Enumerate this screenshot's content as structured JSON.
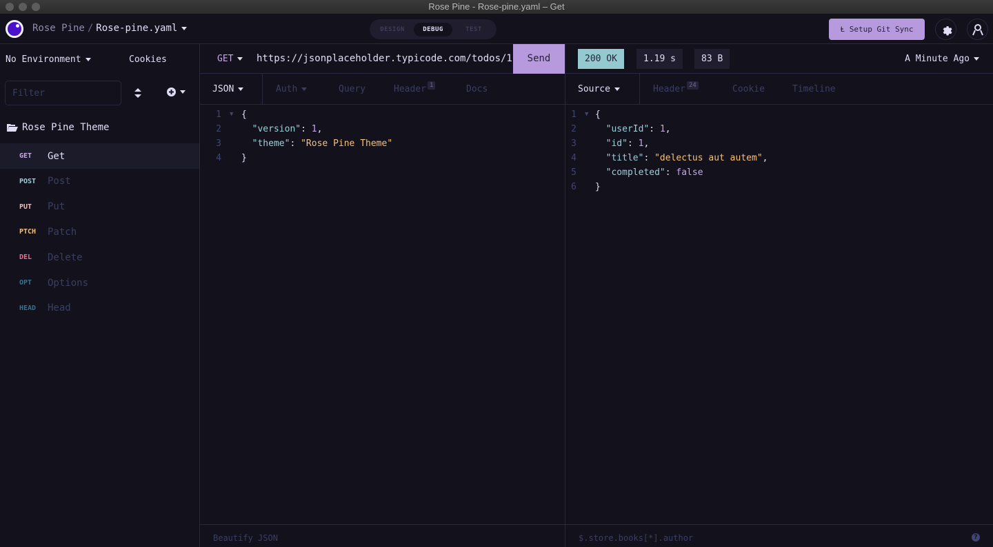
{
  "window": {
    "title": "Rose Pine - Rose-pine.yaml – Get"
  },
  "header": {
    "workspace": "Rose Pine",
    "separator": "/",
    "file": "Rose-pine.yaml",
    "modes": [
      "DESIGN",
      "DEBUG",
      "TEST"
    ],
    "active_mode": "DEBUG",
    "git_sync_label": "Setup Git Sync",
    "icons": {
      "logo": "insomnia-logo-icon",
      "git": "git-branch-icon",
      "settings": "gear-icon",
      "account": "user-icon"
    }
  },
  "sidebar": {
    "environment_label": "No Environment",
    "cookies_label": "Cookies",
    "filter_placeholder": "Filter",
    "folder": "Rose Pine Theme",
    "requests": [
      {
        "method": "GET",
        "name": "Get",
        "color": "#c4a7e7",
        "active": true
      },
      {
        "method": "POST",
        "name": "Post",
        "color": "#9ccfd8",
        "active": false
      },
      {
        "method": "PUT",
        "name": "Put",
        "color": "#ebbcba",
        "active": false
      },
      {
        "method": "PTCH",
        "name": "Patch",
        "color": "#f6c177",
        "active": false
      },
      {
        "method": "DEL",
        "name": "Delete",
        "color": "#eb6f92",
        "active": false
      },
      {
        "method": "OPT",
        "name": "Options",
        "color": "#31748f",
        "active": false
      },
      {
        "method": "HEAD",
        "name": "Head",
        "color": "#31748f",
        "active": false
      }
    ]
  },
  "request": {
    "method": "GET",
    "url": "https://jsonplaceholder.typicode.com/todos/1",
    "send_label": "Send",
    "tabs": [
      {
        "label": "JSON",
        "active": true,
        "dropdown": true
      },
      {
        "label": "Auth",
        "active": false,
        "dropdown": true
      },
      {
        "label": "Query",
        "active": false
      },
      {
        "label": "Header",
        "active": false,
        "badge": "1"
      },
      {
        "label": "Docs",
        "active": false
      }
    ],
    "body_lines": [
      {
        "n": "1",
        "fold": true,
        "parts": [
          {
            "t": "{",
            "c": "p"
          }
        ]
      },
      {
        "n": "2",
        "parts": [
          {
            "t": "  \"version\"",
            "c": "k"
          },
          {
            "t": ": ",
            "c": "p"
          },
          {
            "t": "1",
            "c": "num"
          },
          {
            "t": ",",
            "c": "p"
          }
        ]
      },
      {
        "n": "3",
        "parts": [
          {
            "t": "  \"theme\"",
            "c": "k"
          },
          {
            "t": ": ",
            "c": "p"
          },
          {
            "t": "\"Rose Pine Theme\"",
            "c": "s"
          }
        ]
      },
      {
        "n": "4",
        "parts": [
          {
            "t": "}",
            "c": "p"
          }
        ]
      }
    ],
    "footer_label": "Beautify JSON"
  },
  "response": {
    "status": "200 OK",
    "time": "1.19 s",
    "size": "83 B",
    "history_label": "A Minute Ago",
    "tabs": [
      {
        "label": "Source",
        "active": true,
        "dropdown": true
      },
      {
        "label": "Header",
        "active": false,
        "badge": "24"
      },
      {
        "label": "Cookie",
        "active": false
      },
      {
        "label": "Timeline",
        "active": false
      }
    ],
    "body_lines": [
      {
        "n": "1",
        "fold": true,
        "parts": [
          {
            "t": "{",
            "c": "p"
          }
        ]
      },
      {
        "n": "2",
        "parts": [
          {
            "t": "  \"userId\"",
            "c": "k"
          },
          {
            "t": ": ",
            "c": "p"
          },
          {
            "t": "1",
            "c": "num"
          },
          {
            "t": ",",
            "c": "p"
          }
        ]
      },
      {
        "n": "3",
        "parts": [
          {
            "t": "  \"id\"",
            "c": "k"
          },
          {
            "t": ": ",
            "c": "p"
          },
          {
            "t": "1",
            "c": "num"
          },
          {
            "t": ",",
            "c": "p"
          }
        ]
      },
      {
        "n": "4",
        "parts": [
          {
            "t": "  \"title\"",
            "c": "k"
          },
          {
            "t": ": ",
            "c": "p"
          },
          {
            "t": "\"delectus aut autem\"",
            "c": "s"
          },
          {
            "t": ",",
            "c": "p"
          }
        ]
      },
      {
        "n": "5",
        "parts": [
          {
            "t": "  \"completed\"",
            "c": "k"
          },
          {
            "t": ": ",
            "c": "p"
          },
          {
            "t": "false",
            "c": "num"
          }
        ]
      },
      {
        "n": "6",
        "parts": [
          {
            "t": "}",
            "c": "p"
          }
        ]
      }
    ],
    "filter_placeholder": "$.store.books[*].author",
    "help_icon": "question-circle-icon"
  },
  "colors": {
    "accent": "#b79ade",
    "status_ok": "#95c9d0",
    "background": "#13111c"
  }
}
